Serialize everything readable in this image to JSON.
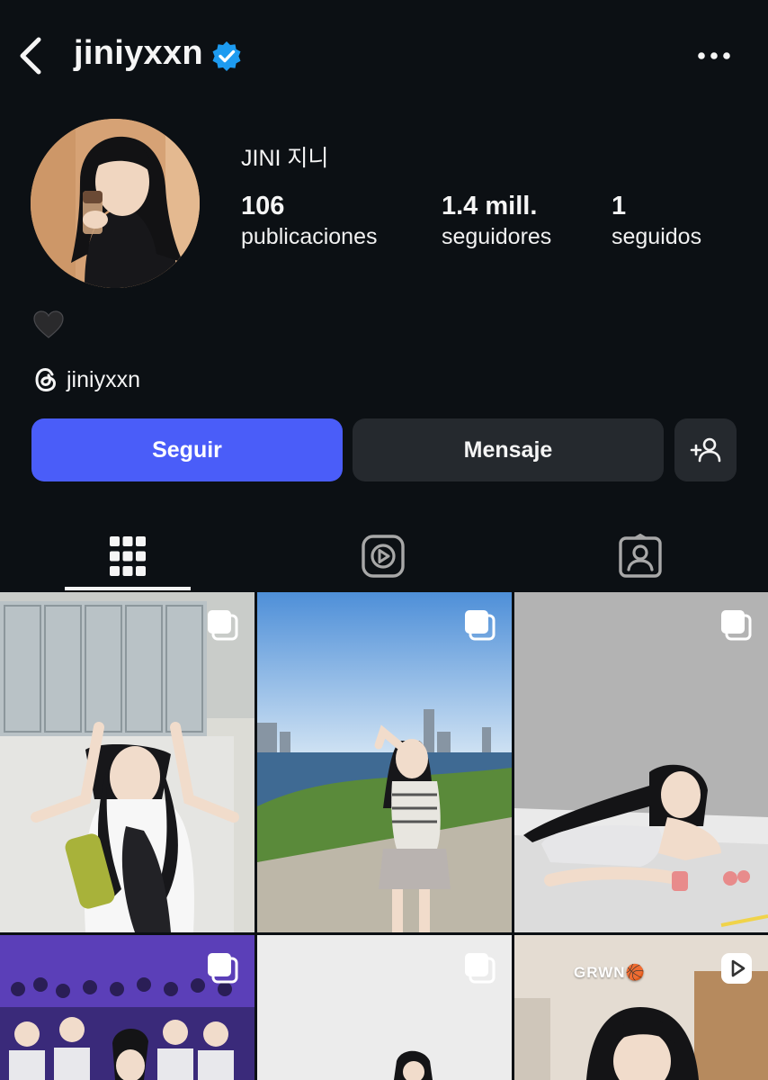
{
  "header": {
    "username": "jiniyxxn",
    "back_icon": "chevron-left-icon",
    "verified_icon": "verified-badge-icon",
    "more_icon": "more-horizontal-icon"
  },
  "profile": {
    "display_name": "JINI 지니",
    "stats": [
      {
        "value": "106",
        "label": "publicaciones"
      },
      {
        "value": "1.4 mill.",
        "label": "seguidores"
      },
      {
        "value": "1",
        "label": "seguidos"
      }
    ],
    "bio_emoji": "black-heart-icon",
    "threads_handle": "jiniyxxn"
  },
  "actions": {
    "follow_label": "Seguir",
    "message_label": "Mensaje",
    "suggest_icon": "add-person-icon"
  },
  "tabs": {
    "active": "grid",
    "items": [
      "grid-icon",
      "reels-icon",
      "tagged-icon"
    ]
  },
  "posts": [
    {
      "type": "carousel",
      "caption_overlay": ""
    },
    {
      "type": "carousel",
      "caption_overlay": ""
    },
    {
      "type": "carousel",
      "caption_overlay": ""
    },
    {
      "type": "carousel",
      "caption_overlay": ""
    },
    {
      "type": "carousel",
      "caption_overlay": ""
    },
    {
      "type": "reel",
      "caption_overlay": "GRWN🏀"
    }
  ],
  "colors": {
    "background": "#0c1014",
    "follow_button": "#4a5df9",
    "secondary_button": "#25292e",
    "verified": "#1d9bf0"
  }
}
